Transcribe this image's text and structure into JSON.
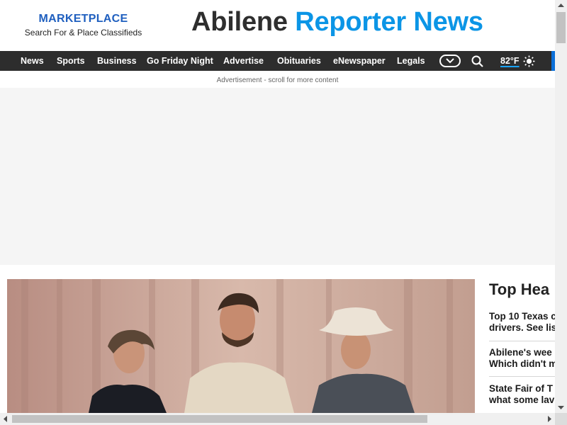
{
  "marketplace": {
    "title": "MARKETPLACE",
    "subtitle": "Search For & Place Classifieds"
  },
  "site": {
    "name_part1": "Abilene",
    "name_part2": "Reporter News",
    "color_dark": "#2e2e2e",
    "color_accent": "#0b95e6"
  },
  "nav": {
    "items": [
      {
        "label": "News"
      },
      {
        "label": "Sports"
      },
      {
        "label": "Business"
      },
      {
        "label": "Go Friday Night"
      },
      {
        "label": "Advertise"
      },
      {
        "label": "Obituaries"
      },
      {
        "label": "eNewspaper"
      },
      {
        "label": "Legals"
      }
    ],
    "more_icon": "chevron-down-icon",
    "search_icon": "search-icon",
    "weather": {
      "temp": "82°F",
      "icon": "sun-icon"
    }
  },
  "ad": {
    "label": "Advertisement - scroll for more content"
  },
  "top_headlines": {
    "title": "Top Hea",
    "items": [
      {
        "line1": "Top 10 Texas c",
        "line2": "drivers. See lis"
      },
      {
        "line1": "Abilene's wee",
        "line2": "Which didn't m"
      },
      {
        "line1": "State Fair of T",
        "line2": "what some lav"
      }
    ]
  }
}
